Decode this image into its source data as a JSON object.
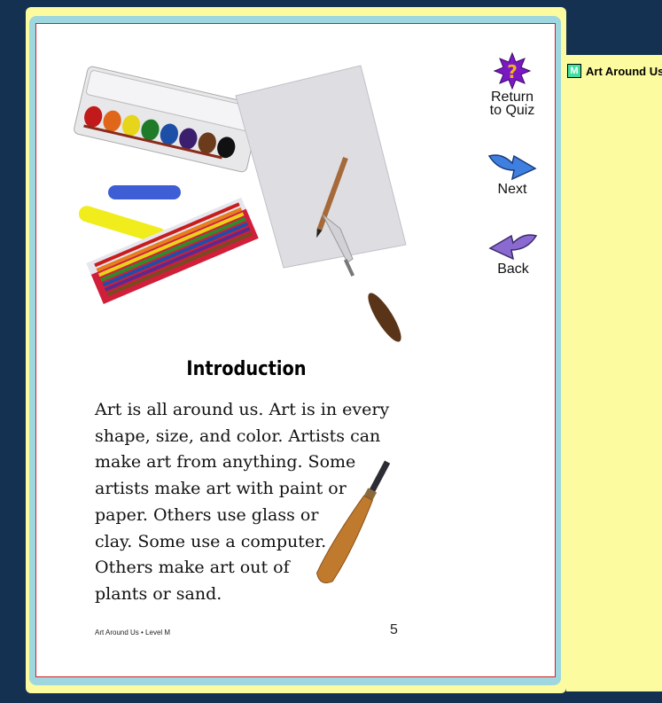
{
  "side_panel": {
    "level_badge": "M",
    "book_title": "Art Around Us"
  },
  "nav": {
    "return_label_line1": "Return",
    "return_label_line2": "to Quiz",
    "next_label": "Next",
    "back_label": "Back"
  },
  "page": {
    "heading": "Introduction",
    "body_lines": [
      "Art is all around us. Art is in every",
      "shape, size, and color. Artists can",
      "make art from anything. Some",
      "artists make art with paint or",
      "paper. Others use glass or",
      "clay. Some use a computer.",
      "Others make art out of",
      "plants or sand."
    ],
    "footer": "Art Around Us • Level M",
    "page_number": "5"
  },
  "colors": {
    "background": "#143152",
    "frame_yellow": "#fdfb9f",
    "frame_teal": "#9fd7e0",
    "page_border": "#c8242a"
  }
}
